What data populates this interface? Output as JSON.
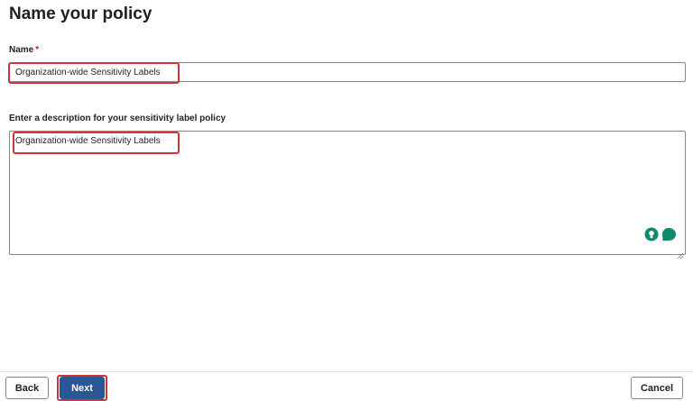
{
  "page": {
    "title": "Name your policy"
  },
  "name_field": {
    "label": "Name",
    "required_marker": "*",
    "value": "Organization-wide Sensitivity Labels"
  },
  "description_field": {
    "label": "Enter a description for your sensitivity label policy",
    "value": "Organization-wide Sensitivity Labels"
  },
  "assist_icons": [
    "lightbulb-icon",
    "chat-bubble-icon"
  ],
  "footer": {
    "back_label": "Back",
    "next_label": "Next",
    "cancel_label": "Cancel"
  },
  "colors": {
    "primary": "#2b5797",
    "highlight": "#d13438",
    "assist_green": "#0f8a6c"
  }
}
